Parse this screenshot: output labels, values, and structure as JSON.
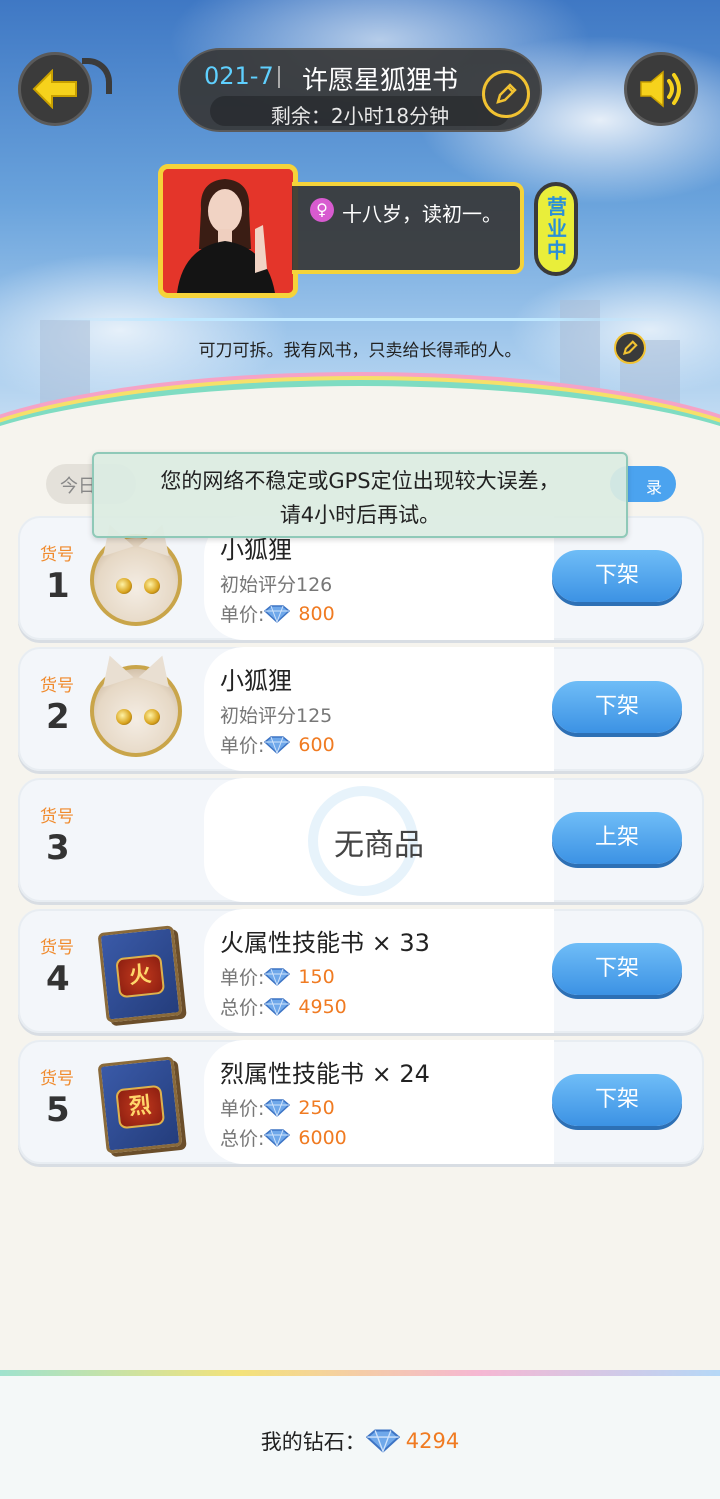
{
  "header": {
    "code": "021-7",
    "shop_name": "许愿星狐狸书",
    "remaining": "剩余：2小时18分钟"
  },
  "owner": {
    "description": "十八岁，读初一。",
    "status": "营业中",
    "motto": "可刀可拆。我有风书，只卖给长得乖的人。"
  },
  "filter": {
    "today_label": "今日",
    "record_label": "录"
  },
  "toast": {
    "line1": "您的网络不稳定或GPS定位出现较大误差，",
    "line2": "请4小时后再试。"
  },
  "slot_label": "货号",
  "items": [
    {
      "slot": "1",
      "name": "小狐狸",
      "rating": "初始评分126",
      "unit_label": "单价:",
      "unit_price": "800",
      "action": "下架"
    },
    {
      "slot": "2",
      "name": "小狐狸",
      "rating": "初始评分125",
      "unit_label": "单价:",
      "unit_price": "600",
      "action": "下架"
    },
    {
      "slot": "3",
      "empty_text": "无商品",
      "action": "上架"
    },
    {
      "slot": "4",
      "name": "火属性技能书 × 33",
      "emblem": "火",
      "unit_label": "单价:",
      "unit_price": "150",
      "total_label": "总价:",
      "total_price": "4950",
      "action": "下架"
    },
    {
      "slot": "5",
      "name": "烈属性技能书 × 24",
      "emblem": "烈",
      "unit_label": "单价:",
      "unit_price": "250",
      "total_label": "总价:",
      "total_price": "6000",
      "action": "下架"
    }
  ],
  "footer": {
    "label": "我的钻石：",
    "diamonds": "4294"
  },
  "colors": {
    "accent_blue": "#3c92e4",
    "price_orange": "#f07b22",
    "gold": "#f5d33a"
  }
}
